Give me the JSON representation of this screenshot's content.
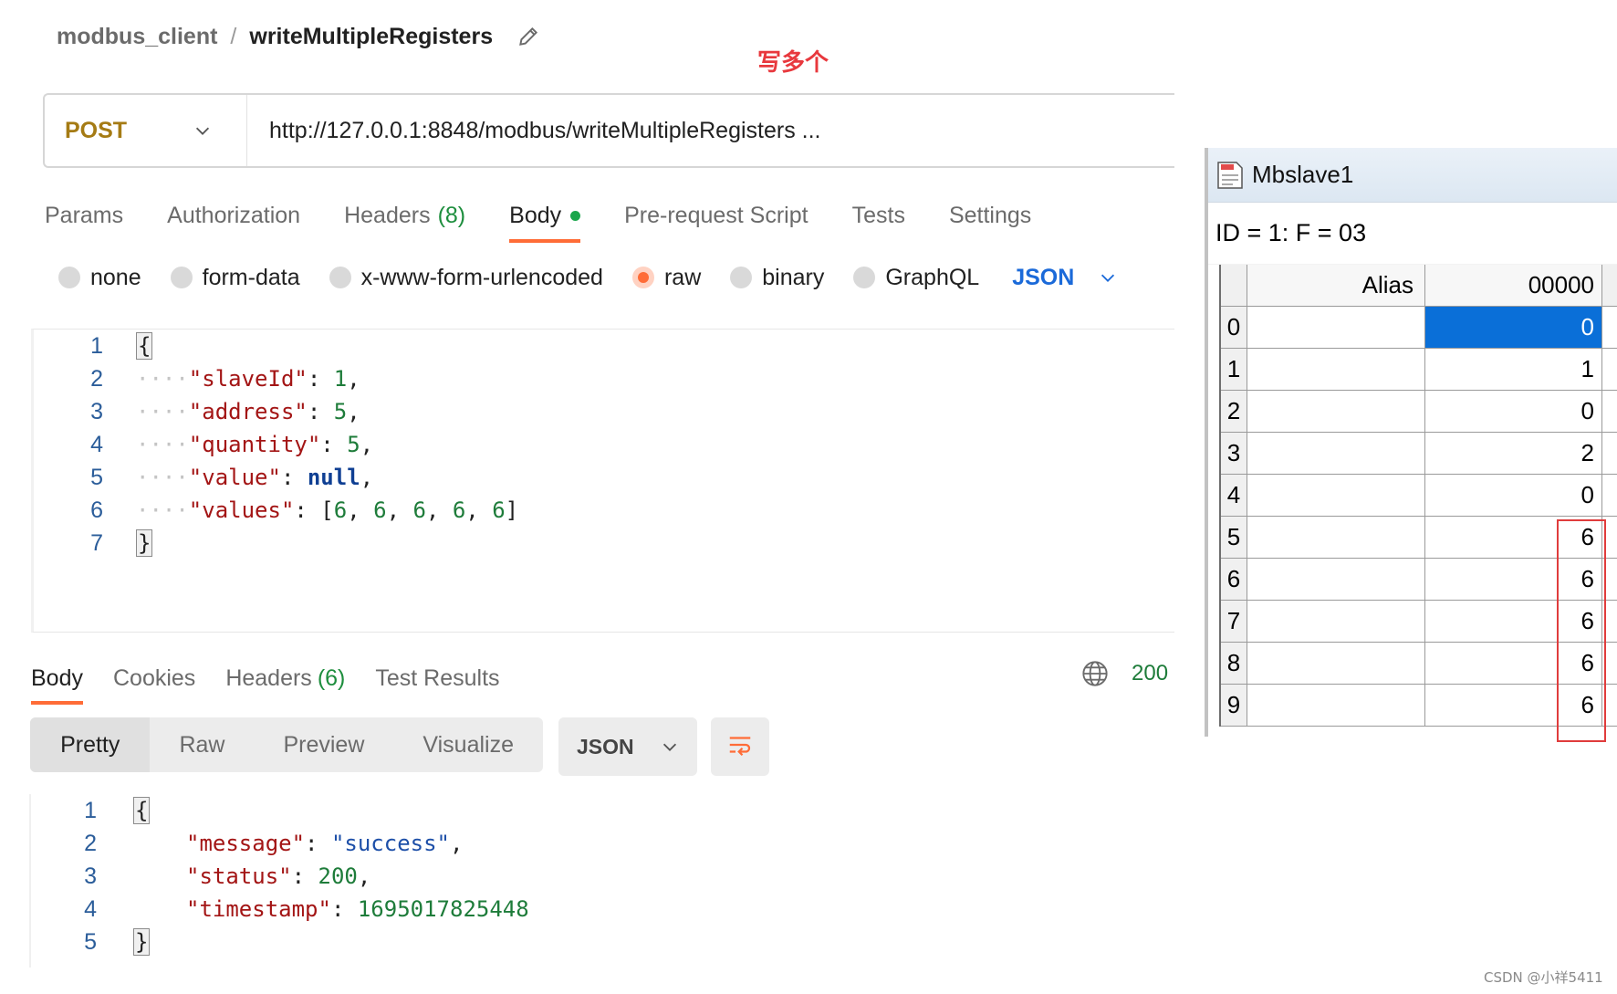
{
  "breadcrumb": {
    "collection": "modbus_client",
    "separator": "/",
    "request": "writeMultipleRegisters"
  },
  "annotation": "写多个",
  "request": {
    "method": "POST",
    "url": "http://127.0.0.1:8848/modbus/writeMultipleRegisters ..."
  },
  "request_tabs": {
    "params": "Params",
    "authorization": "Authorization",
    "headers": "Headers",
    "headers_count": "(8)",
    "body": "Body",
    "prerequest": "Pre-request Script",
    "tests": "Tests",
    "settings": "Settings"
  },
  "body_types": {
    "none": "none",
    "form_data": "form-data",
    "urlencoded": "x-www-form-urlencoded",
    "raw": "raw",
    "binary": "binary",
    "graphql": "GraphQL",
    "format": "JSON",
    "selected": "raw"
  },
  "request_body": {
    "line_numbers": [
      "1",
      "2",
      "3",
      "4",
      "5",
      "6",
      "7"
    ],
    "open_brace": "{",
    "close_brace": "}",
    "indent": "····",
    "slaveId_key": "\"slaveId\"",
    "slaveId_val": "1",
    "address_key": "\"address\"",
    "address_val": "5",
    "quantity_key": "\"quantity\"",
    "quantity_val": "5",
    "value_key": "\"value\"",
    "value_val": "null",
    "values_key": "\"values\"",
    "values_list": [
      "6",
      "6",
      "6",
      "6",
      "6"
    ]
  },
  "response_tabs": {
    "body": "Body",
    "cookies": "Cookies",
    "headers": "Headers",
    "headers_count": "(6)",
    "test_results": "Test Results",
    "status": "200"
  },
  "response_view": {
    "pretty": "Pretty",
    "raw": "Raw",
    "preview": "Preview",
    "visualize": "Visualize",
    "format": "JSON"
  },
  "response_body": {
    "line_numbers": [
      "1",
      "2",
      "3",
      "4",
      "5"
    ],
    "open_brace": "{",
    "close_brace": "}",
    "message_key": "\"message\"",
    "message_val": "\"success\"",
    "status_key": "\"status\"",
    "status_val": "200",
    "timestamp_key": "\"timestamp\"",
    "timestamp_val": "1695017825448"
  },
  "mbslave": {
    "title": "Mbslave1",
    "info": "ID = 1: F = 03",
    "header_alias": "Alias",
    "header_address": "00000",
    "rows": [
      {
        "idx": "0",
        "alias": "",
        "value": "0"
      },
      {
        "idx": "1",
        "alias": "",
        "value": "1"
      },
      {
        "idx": "2",
        "alias": "",
        "value": "0"
      },
      {
        "idx": "3",
        "alias": "",
        "value": "2"
      },
      {
        "idx": "4",
        "alias": "",
        "value": "0"
      },
      {
        "idx": "5",
        "alias": "",
        "value": "6"
      },
      {
        "idx": "6",
        "alias": "",
        "value": "6"
      },
      {
        "idx": "7",
        "alias": "",
        "value": "6"
      },
      {
        "idx": "8",
        "alias": "",
        "value": "6"
      },
      {
        "idx": "9",
        "alias": "",
        "value": "6"
      }
    ],
    "selected_row": "0"
  },
  "watermark": "CSDN @小祥5411",
  "colors": {
    "accent": "#ff6c37",
    "method": "#a57b14",
    "link": "#1b6ad9",
    "success": "#1e7c3a",
    "selection": "#0a6fd8",
    "annotation": "#e8383d"
  }
}
